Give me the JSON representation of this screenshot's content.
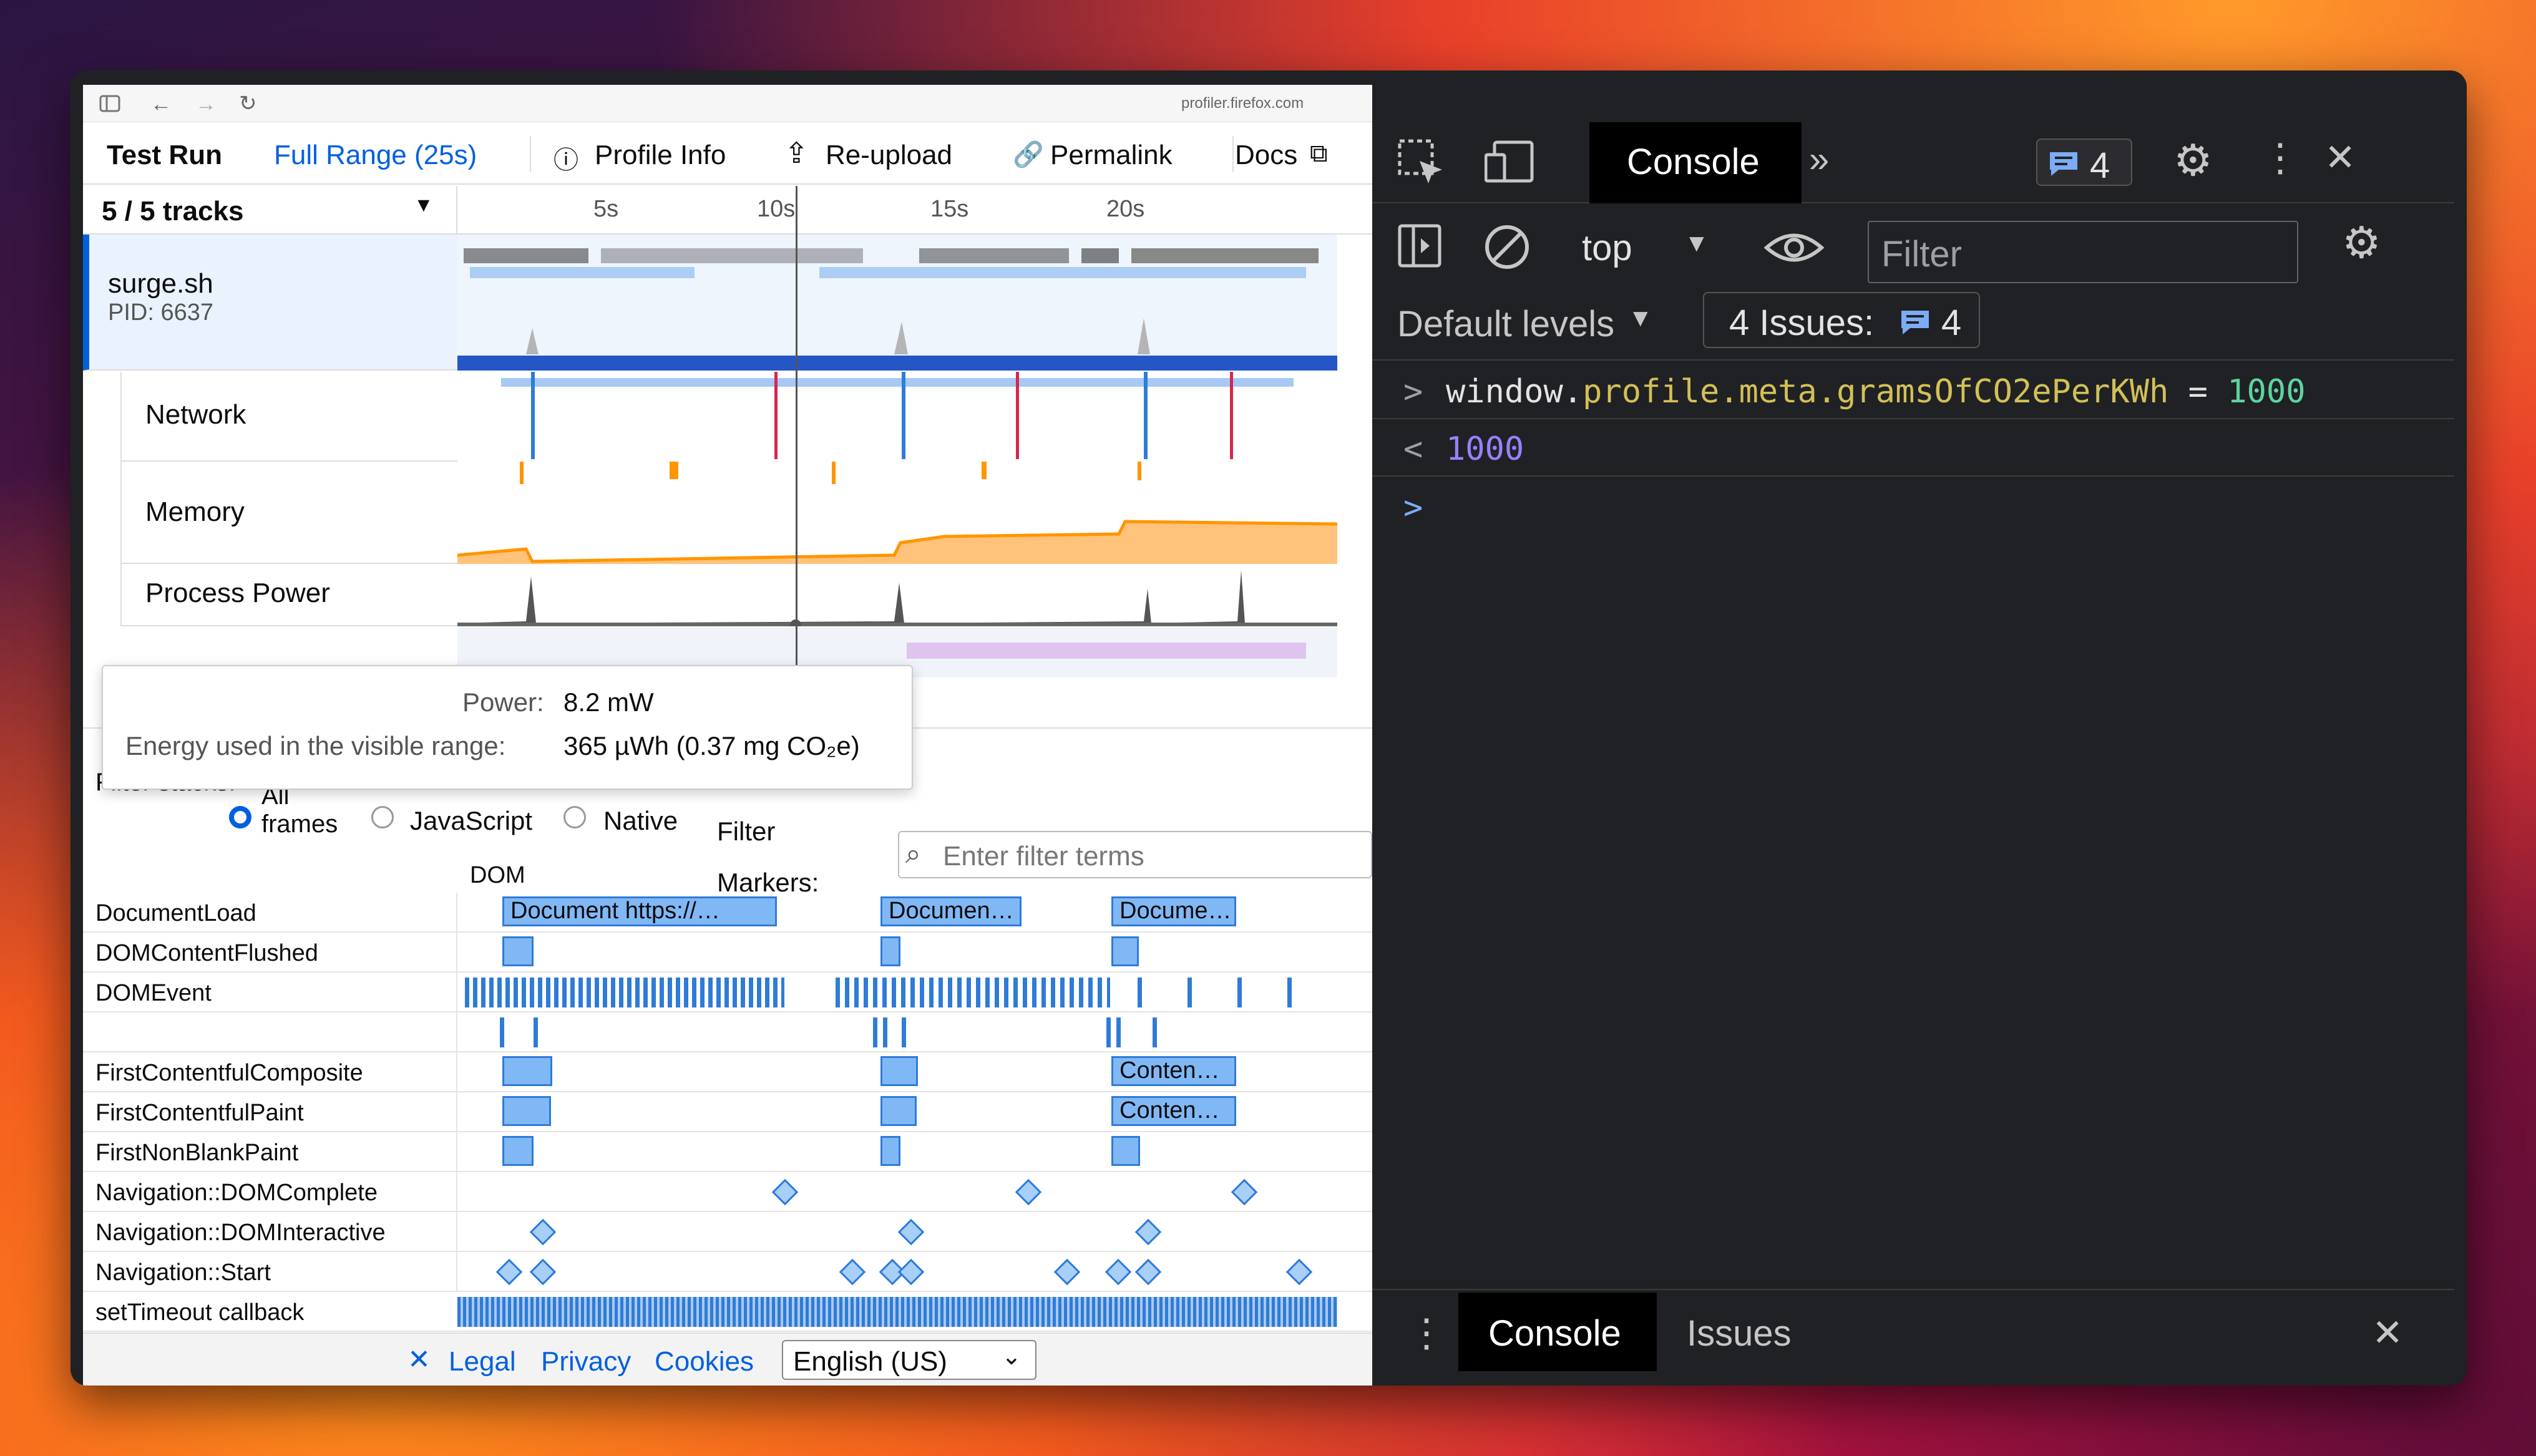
{
  "browser": {
    "url": "profiler.firefox.com"
  },
  "toolbar": {
    "run_label": "Test Run",
    "range": "Full Range (25s)",
    "profile_info": "Profile Info",
    "reupload": "Re-upload",
    "permalink": "Permalink",
    "docs": "Docs"
  },
  "timeline": {
    "tracks_label": "5 / 5 tracks",
    "ticks": [
      "5s",
      "10s",
      "15s",
      "20s"
    ],
    "process": {
      "name": "surge.sh",
      "pid": "PID: 6637"
    },
    "tracks": [
      "Network",
      "Memory",
      "Process Power"
    ]
  },
  "tooltip": {
    "power_label": "Power:",
    "power_value": "8.2 mW",
    "energy_label": "Energy used in the visible range:",
    "energy_value": "365 µWh (0.37 mg CO₂e)"
  },
  "filters": {
    "filter_stacks": "Filter stacks:",
    "all_frames": "All frames",
    "javascript": "JavaScript",
    "native": "Native",
    "filter_markers": "Filter Markers:",
    "search_placeholder": "Enter filter terms"
  },
  "markers": {
    "group": "DOM",
    "rows": [
      "DocumentLoad",
      "DOMContentFlushed",
      "DOMEvent",
      "",
      "FirstContentfulComposite",
      "FirstContentfulPaint",
      "FirstNonBlankPaint",
      "Navigation::DOMComplete",
      "Navigation::DOMInteractive",
      "Navigation::Start",
      "setTimeout callback"
    ],
    "doc_labels": [
      "Document https://…",
      "Documen…",
      "Docume…"
    ],
    "content_label": "Conten…"
  },
  "footer": {
    "legal": "Legal",
    "privacy": "Privacy",
    "cookies": "Cookies",
    "language": "English (US)"
  },
  "devtools": {
    "console_tab": "Console",
    "badge_count": "4",
    "context": "top",
    "filter_placeholder": "Filter",
    "levels": "Default levels",
    "issues_label": "4 Issues:",
    "issues_count": "4",
    "lines": [
      {
        "prefix": ">",
        "code_a": "window.",
        "code_b": "profile",
        "code_c": ".meta.gramsOfCO2ePerKWh",
        "code_d": " = ",
        "code_e": "1000"
      },
      {
        "prefix": "<",
        "result": "1000"
      }
    ],
    "drawer": {
      "console": "Console",
      "issues": "Issues"
    }
  },
  "colors": {
    "accent": "#0060df",
    "marker_fill": "#80b8f5",
    "marker_stroke": "#2f7bd8",
    "memory": "#ff9500",
    "devtools_bg": "#202124"
  }
}
